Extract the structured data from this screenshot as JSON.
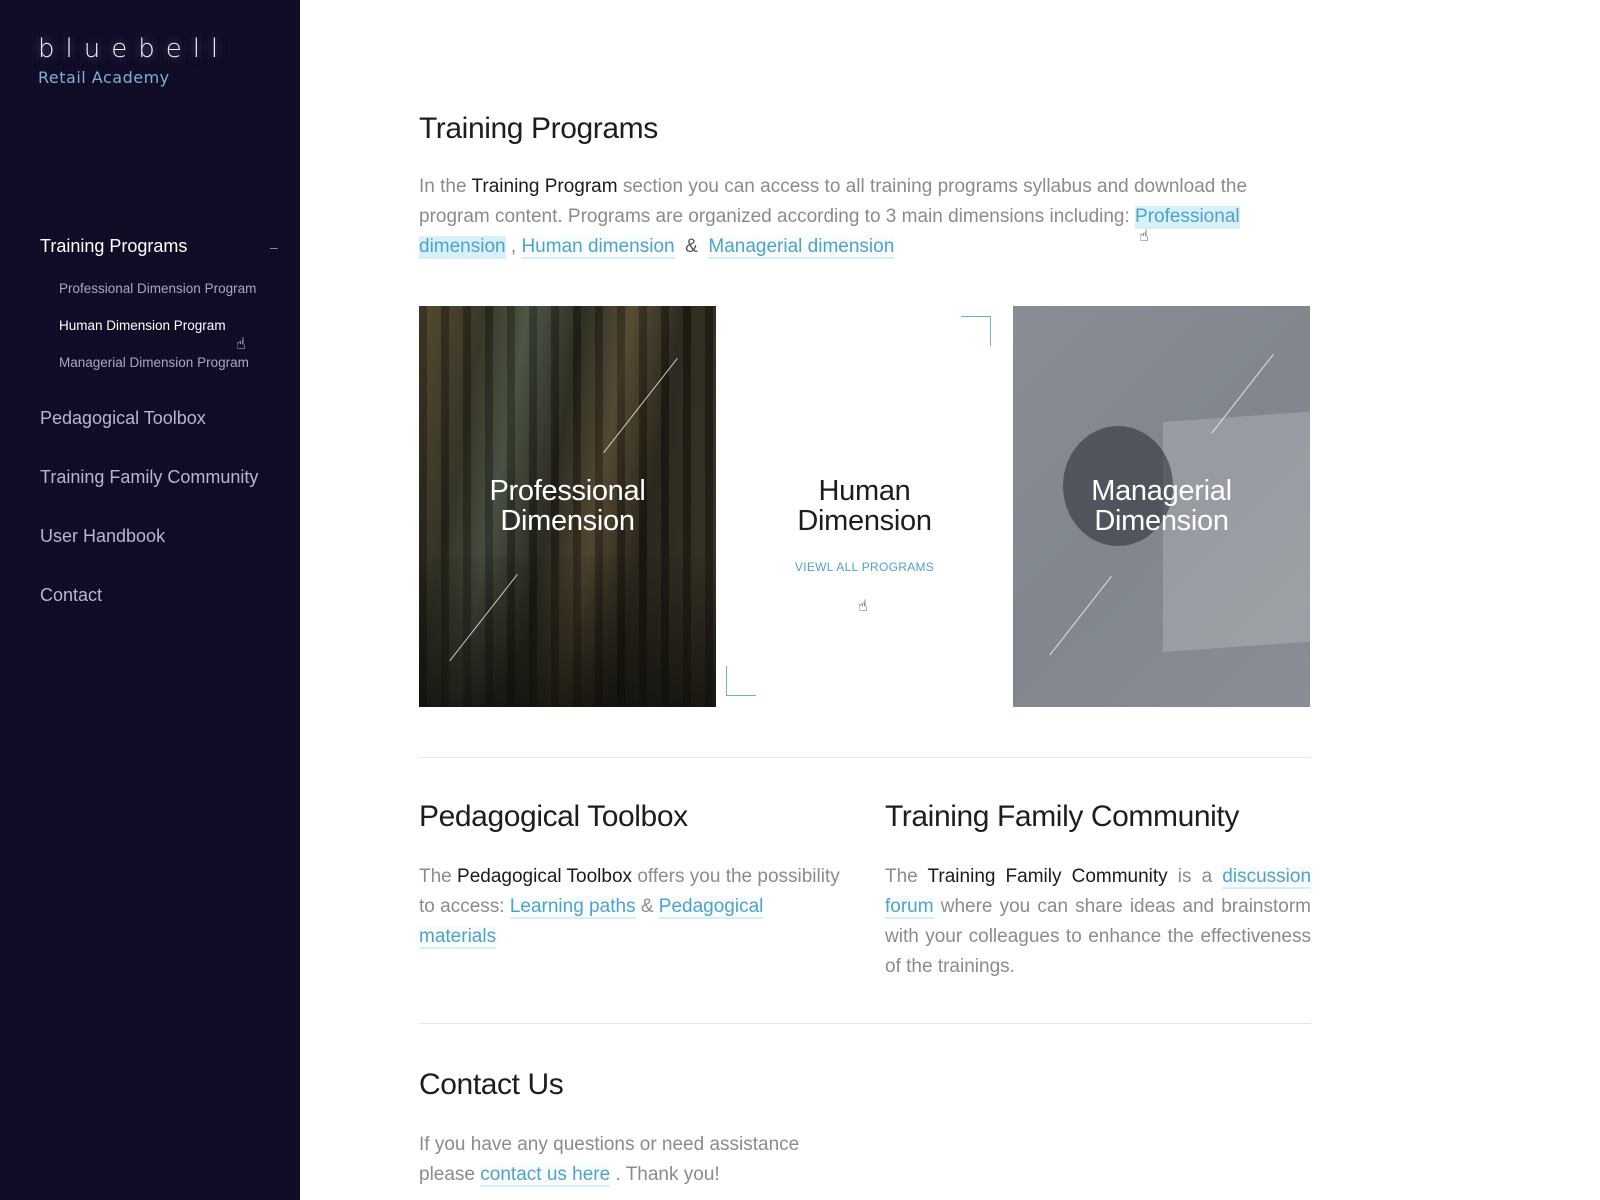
{
  "brand": {
    "name": "bluebell",
    "subtitle": "Retail Academy"
  },
  "sidebar": {
    "active": {
      "label": "Training Programs",
      "toggle": "–",
      "children": [
        {
          "label": "Professional Dimension Program"
        },
        {
          "label": "Human Dimension Program"
        },
        {
          "label": "Managerial Dimension Program"
        }
      ]
    },
    "items": [
      {
        "label": "Pedagogical Toolbox"
      },
      {
        "label": "Training Family Community"
      },
      {
        "label": "User Handbook"
      },
      {
        "label": "Contact"
      }
    ]
  },
  "training_programs": {
    "title": "Training Programs",
    "intro_1": "In the ",
    "intro_strong": "Training Program",
    "intro_2": " section you can access to all training programs syllabus and download the program content. Programs are organized according to 3 main dimensions including: ",
    "link_professional": "Professional dimension",
    "comma": " , ",
    "link_human": "Human dimension",
    "amp": "  &  ",
    "link_managerial": "Managerial dimension"
  },
  "cards": {
    "professional": {
      "title_1": "Professional",
      "title_2": "Dimension"
    },
    "human": {
      "title_1": "Human",
      "title_2": "Dimension",
      "link": "VIEWL ALL PROGRAMS"
    },
    "managerial": {
      "title_1": "Managerial",
      "title_2": "Dimension"
    }
  },
  "toolbox": {
    "title": "Pedagogical Toolbox",
    "text_1": "The ",
    "text_strong": "Pedagogical Toolbox",
    "text_2": " offers you the possibility to access: ",
    "link_paths": "Learning paths",
    "amp": " & ",
    "link_materials": "Pedagogical materials"
  },
  "community": {
    "title": "Training Family Community",
    "text_1": "The ",
    "text_strong": "Training Family Community",
    "text_2": " is a ",
    "link_forum": "discussion forum",
    "text_3": " where you can share ideas and brainstorm with your colleagues to enhance the effectiveness of the trainings."
  },
  "contact": {
    "title": "Contact Us",
    "text_1": "If you have any questions or need assistance please ",
    "link": "contact us here",
    "text_2": " . Thank you!"
  },
  "colors": {
    "sidebar_bg": "#0f0b26",
    "accent": "#4fa3c7",
    "link_highlight": "#d8f0fa"
  }
}
